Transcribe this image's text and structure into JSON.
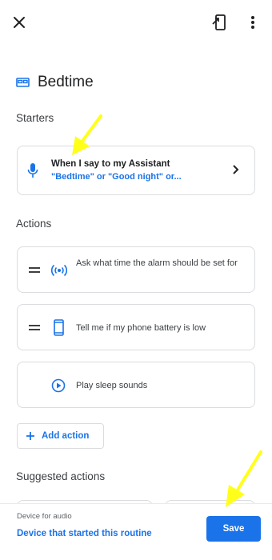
{
  "header": {
    "icons": [
      "close-icon",
      "open-in-phone-icon",
      "more-vert-icon"
    ]
  },
  "title": {
    "icon": "bed-icon",
    "text": "Bedtime"
  },
  "starters": {
    "label": "Starters",
    "item": {
      "icon": "mic-icon",
      "title": "When I say to my Assistant",
      "subtitle": "\"Bedtime\" or \"Good night\" or..."
    }
  },
  "actions": {
    "label": "Actions",
    "items": [
      {
        "icon": "broadcast-icon",
        "text": "Ask what time the alarm should be set for"
      },
      {
        "icon": "phone-icon",
        "text": "Tell me if my phone battery is low"
      },
      {
        "icon": "play-circle-icon",
        "text": "Play sleep sounds"
      }
    ],
    "add_label": "Add action"
  },
  "suggested": {
    "label": "Suggested actions"
  },
  "footer": {
    "device_label": "Device for audio",
    "device_value": "Device that started this routine",
    "save_label": "Save"
  },
  "colors": {
    "accent": "#1a73e8",
    "annotation_arrow": "#ffff1a",
    "border": "#dadce0"
  }
}
